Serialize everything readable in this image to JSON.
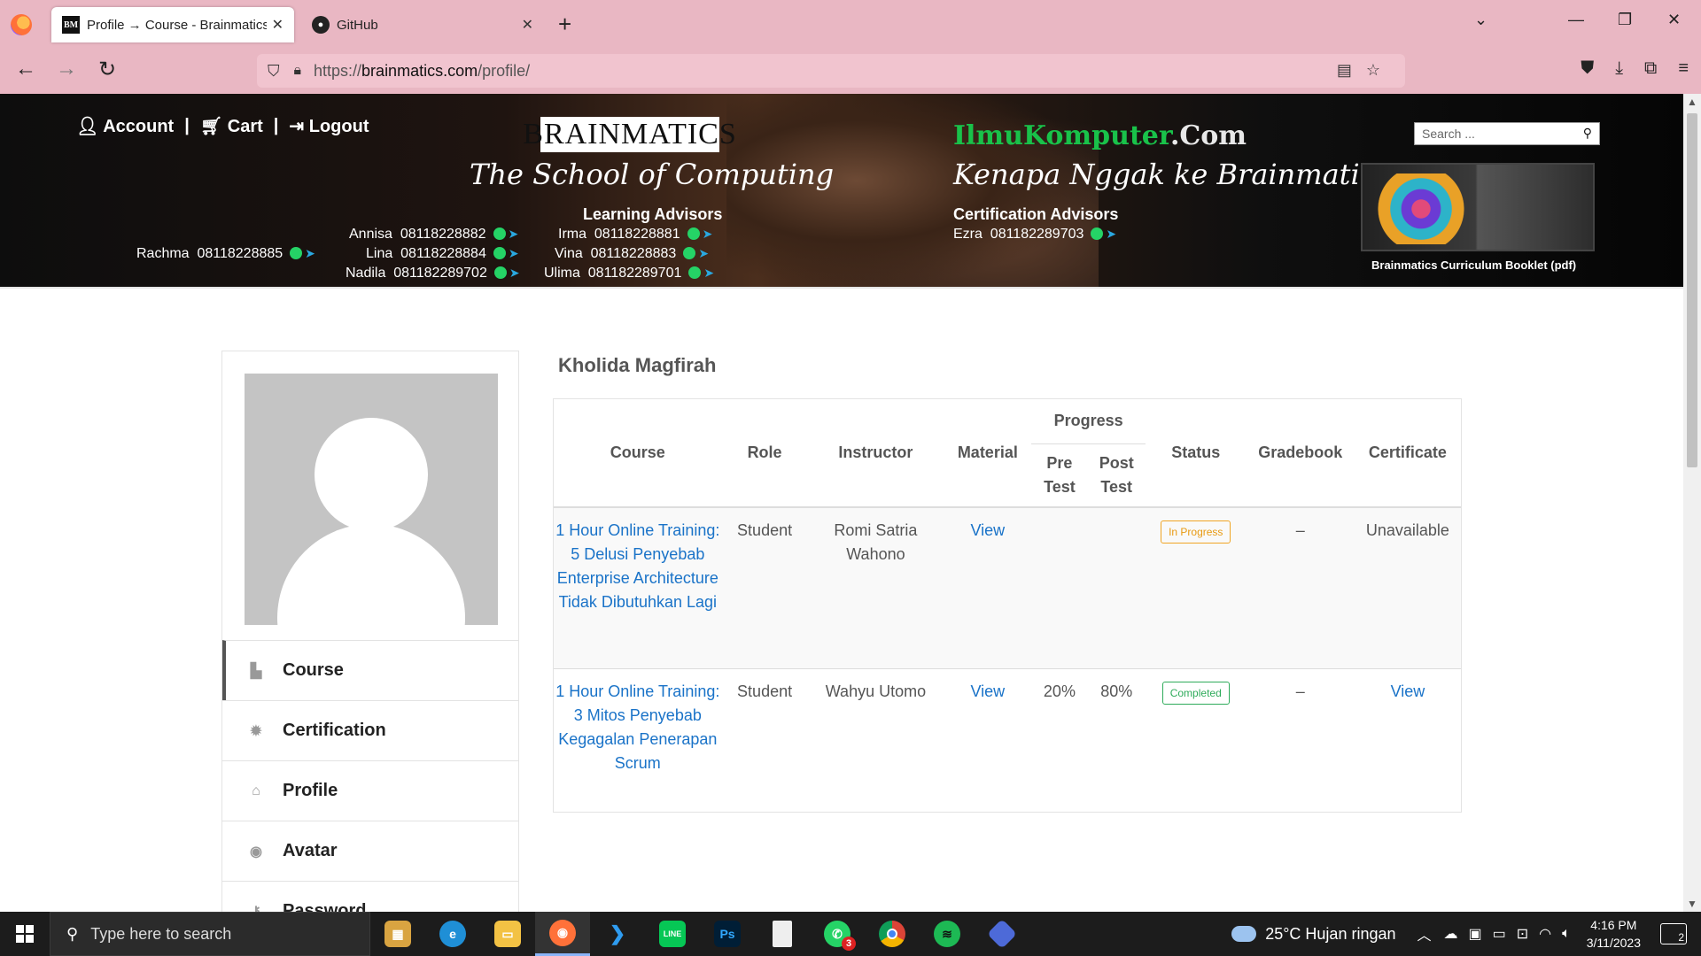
{
  "browser": {
    "tabs": [
      {
        "title": "Profile → Course - Brainmatics",
        "favicon": "BM",
        "active": true
      },
      {
        "title": "GitHub",
        "favicon": "GH",
        "active": false
      }
    ],
    "url_prefix": "https://",
    "url_host": "brainmatics.com",
    "url_path": "/profile/"
  },
  "header": {
    "nav": {
      "account": "Account",
      "cart": "Cart",
      "logout": "Logout",
      "sep": "|"
    },
    "brand": "BRAINMATICS",
    "tagline_left": "The School of Computing",
    "tagline_right": "Kenapa Nggak ke Brainmatics Aja?",
    "learning_advisors_title": "Learning Advisors",
    "certification_advisors_title": "Certification Advisors",
    "ilmu_green": "IlmuKomputer",
    "ilmu_suffix": ".Com",
    "search_placeholder": "Search ...",
    "booklet_label": "Brainmatics Curriculum Booklet (pdf)",
    "advisors": [
      {
        "name": "Rachma",
        "phone": "08118228885"
      },
      {
        "name": "Annisa",
        "phone": "08118228882"
      },
      {
        "name": "Lina",
        "phone": "08118228884"
      },
      {
        "name": "Nadila",
        "phone": "081182289702"
      },
      {
        "name": "Irma",
        "phone": "08118228881"
      },
      {
        "name": "Vina",
        "phone": "08118228883"
      },
      {
        "name": "Ulima",
        "phone": "081182289701"
      },
      {
        "name": "Ezra",
        "phone": "081182289703"
      }
    ]
  },
  "sidebar": {
    "items": [
      {
        "label": "Course",
        "icon": "book-icon"
      },
      {
        "label": "Certification",
        "icon": "badge-icon"
      },
      {
        "label": "Profile",
        "icon": "home-icon"
      },
      {
        "label": "Avatar",
        "icon": "user-circle-icon"
      },
      {
        "label": "Password",
        "icon": "key-icon"
      }
    ]
  },
  "profile": {
    "name": "Kholida Magfirah"
  },
  "table": {
    "headers": {
      "course": "Course",
      "role": "Role",
      "instructor": "Instructor",
      "material": "Material",
      "progress": "Progress",
      "pre_test": "Pre Test",
      "post_test": "Post Test",
      "status": "Status",
      "gradebook": "Gradebook",
      "certificate": "Certificate"
    },
    "rows": [
      {
        "course": "1 Hour Online Training: 5 Delusi Penyebab Enterprise Architecture Tidak Dibutuhkan Lagi",
        "role": "Student",
        "instructor": "Romi Satria Wahono",
        "material": "View",
        "pre_test": "",
        "post_test": "",
        "status": "In Progress",
        "gradebook": "–",
        "certificate": "Unavailable"
      },
      {
        "course": "1 Hour Online Training: 3 Mitos Penyebab Kegagalan Penerapan Scrum",
        "role": "Student",
        "instructor": "Wahyu Utomo",
        "material": "View",
        "pre_test": "20%",
        "post_test": "80%",
        "status": "Completed",
        "gradebook": "–",
        "certificate": "View"
      }
    ]
  },
  "taskbar": {
    "search_placeholder": "Type here to search",
    "weather": "25°C  Hujan ringan",
    "time": "4:16 PM",
    "date": "3/11/2023",
    "whatsapp_badge": "3",
    "notification_count": "2"
  },
  "colors": {
    "chrome": "#e9b7c3",
    "link": "#1a73c8",
    "in_progress": "#f0a524",
    "completed": "#2eab5a"
  }
}
